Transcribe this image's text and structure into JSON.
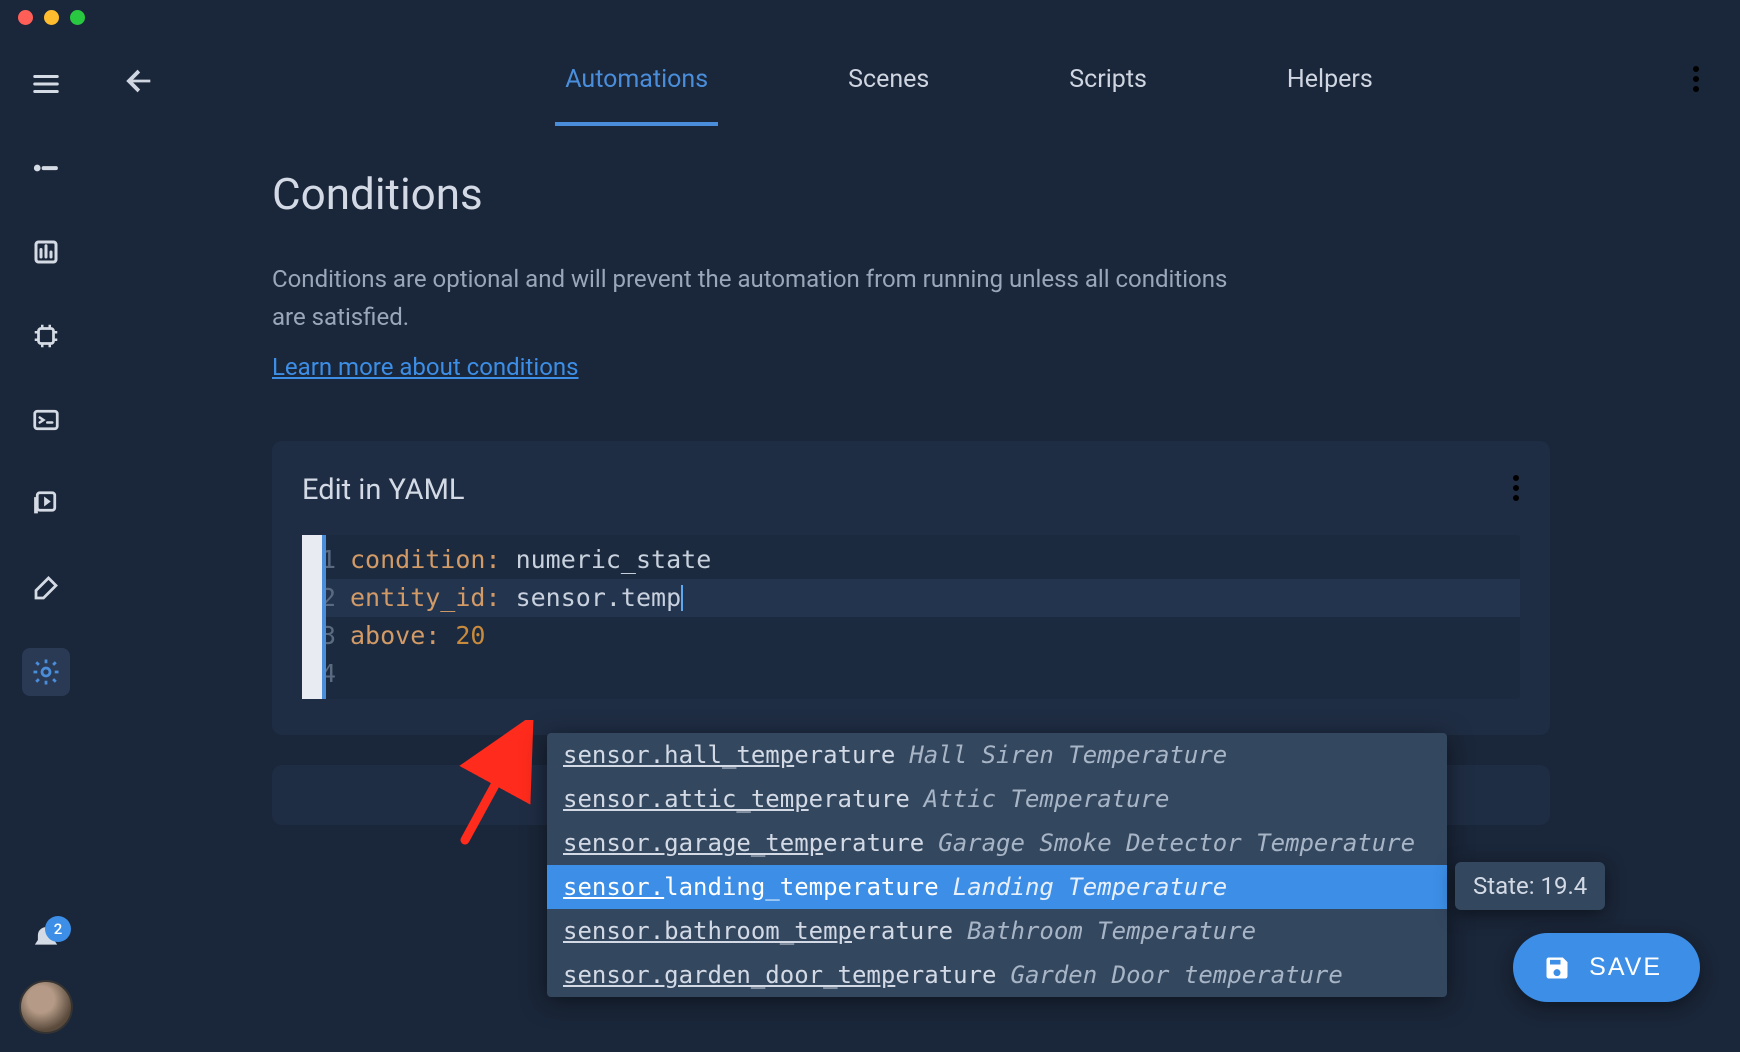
{
  "tabs": [
    "Automations",
    "Scenes",
    "Scripts",
    "Helpers"
  ],
  "active_tab_index": 0,
  "page": {
    "heading": "Conditions",
    "description": "Conditions are optional and will prevent the automation from running unless all conditions are satisfied.",
    "learn_more": "Learn more about conditions"
  },
  "card": {
    "title": "Edit in YAML",
    "lines": [
      {
        "n": 1,
        "key": "condition",
        "value": "numeric_state"
      },
      {
        "n": 2,
        "key": "entity_id",
        "value": "sensor.temp",
        "cursor": true
      },
      {
        "n": 3,
        "key": "above",
        "value": "20",
        "numeric": true
      },
      {
        "n": 4,
        "key": "",
        "value": ""
      }
    ]
  },
  "autocomplete": {
    "selected_index": 3,
    "items": [
      {
        "id": "sensor.hall_temperature",
        "match": "sensor.hall_temp",
        "label": "Hall Siren Temperature"
      },
      {
        "id": "sensor.attic_temperature",
        "match": "sensor.attic_temp",
        "label": "Attic Temperature"
      },
      {
        "id": "sensor.garage_temperature",
        "match": "sensor.garage_temp",
        "label": "Garage Smoke Detector Temperature"
      },
      {
        "id": "sensor.landing_temperature",
        "match": "sensor.",
        "label": "Landing Temperature"
      },
      {
        "id": "sensor.bathroom_temperature",
        "match": "sensor.bathroom_temp",
        "label": "Bathroom Temperature"
      },
      {
        "id": "sensor.garden_door_temperature",
        "match": "sensor.garden_door_temp",
        "label": "Garden Door temperature"
      }
    ]
  },
  "state_tooltip": "State: 19.4",
  "save_button": "SAVE",
  "notification_count": "2",
  "sidebar_icons": [
    "hamburger",
    "overview",
    "history",
    "chip",
    "devtools",
    "media",
    "build",
    "settings"
  ],
  "sidebar_active": "settings"
}
